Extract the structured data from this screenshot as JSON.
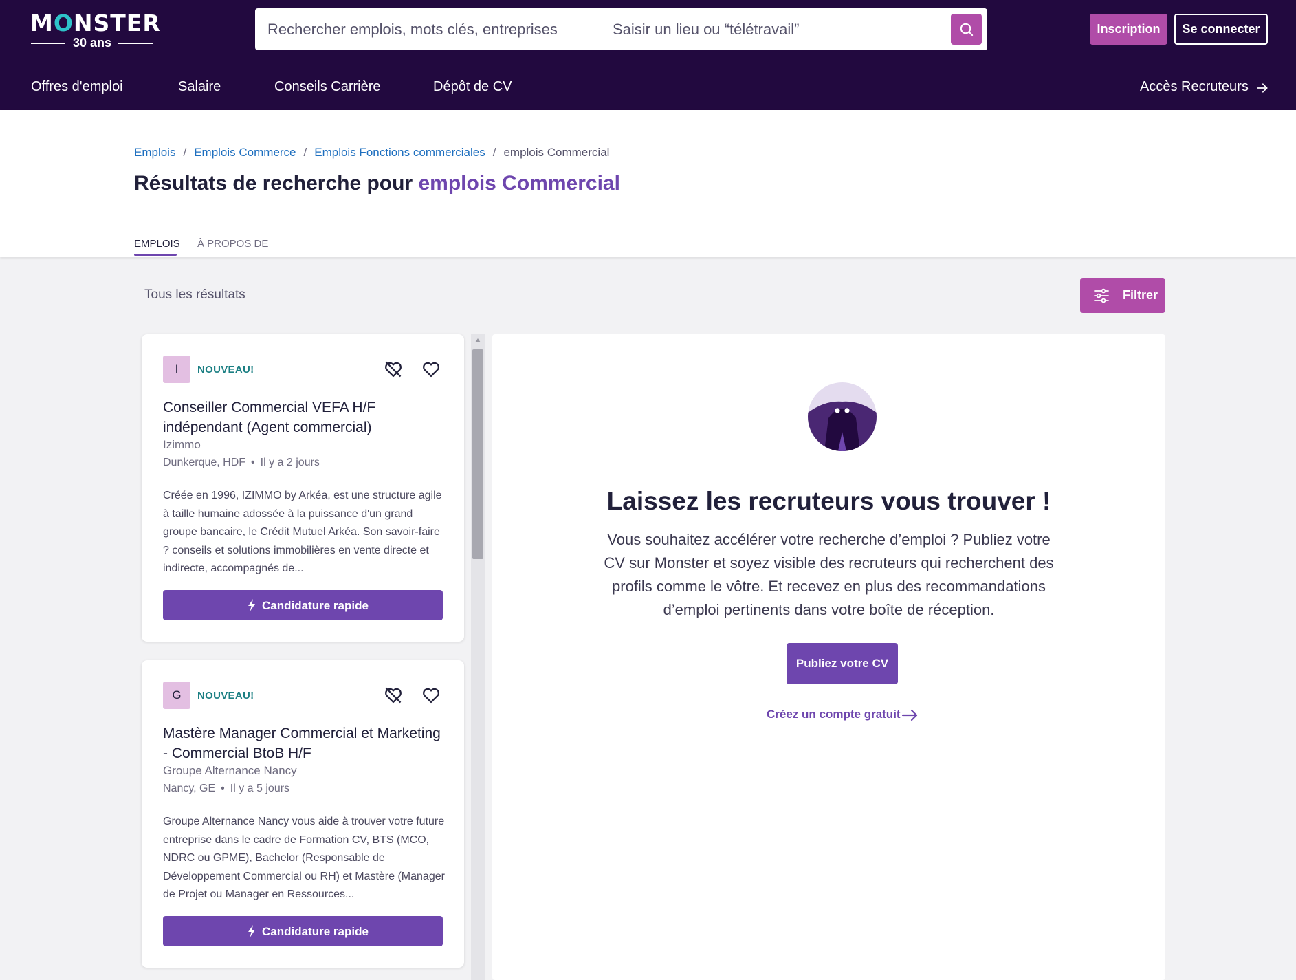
{
  "header": {
    "logo_text_pre": "M",
    "logo_text_o": "O",
    "logo_text_post": "NSTER",
    "logo_subtitle": "30 ans",
    "search_query_placeholder": "Rechercher emplois, mots clés, entreprises",
    "search_location_placeholder": "Saisir un lieu ou “télétravail”",
    "signup_label": "Inscription",
    "login_label": "Se connecter",
    "nav": [
      "Offres d'emploi",
      "Salaire",
      "Conseils Carrière",
      "Dépôt de CV"
    ],
    "recruiter_label": "Accès Recruteurs",
    "icons": [
      "search-icon",
      "arrow-right-icon"
    ]
  },
  "breadcrumb": {
    "items": [
      "Emplois",
      "Emplois Commerce",
      "Emplois Fonctions commerciales"
    ],
    "current": "emplois Commercial"
  },
  "title": {
    "prefix": "Résultats de recherche pour",
    "highlight": "emplois Commercial"
  },
  "tabs": [
    "EMPLOIS",
    "À PROPOS DE"
  ],
  "results": {
    "label": "Tous les résultats",
    "filter_label": "Filtrer"
  },
  "jobs": [
    {
      "logo_letter": "I",
      "badge": "NOUVEAU!",
      "title": "Conseiller Commercial VEFA H/F indépendant (Agent commercial)",
      "company": "Izimmo",
      "location": "Dunkerque, HDF",
      "posted": "Il y a 2 jours",
      "description": "Créée en 1996, IZIMMO by Arkéa, est une structure agile à taille humaine adossée à la puissance d'un grand groupe bancaire, le Crédit Mutuel Arkéa. Son savoir-faire ? conseils et solutions immobilières en vente directe et indirecte, accompagnés de...",
      "apply_label": "Candidature rapide"
    },
    {
      "logo_letter": "G",
      "badge": "NOUVEAU!",
      "title": "Mastère Manager Commercial et Marketing - Commercial BtoB H/F",
      "company": "Groupe Alternance Nancy",
      "location": "Nancy, GE",
      "posted": "Il y a 5 jours",
      "description": "Groupe Alternance Nancy vous aide à trouver votre future entreprise dans le cadre de Formation CV, BTS (MCO, NDRC ou GPME), Bachelor (Responsable de Développement Commercial ou RH) et Mastère (Manager de Projet ou Manager en Ressources...",
      "apply_label": "Candidature rapide"
    }
  ],
  "promo": {
    "heading": "Laissez les recruteurs vous trouver !",
    "body": "Vous souhaitez accélérer votre recherche d’emploi ? Publiez votre CV sur Monster et soyez visible des recruteurs qui recherchent des profils comme le vôtre. Et recevez en plus des recommandations d’emploi pertinents dans votre boîte de réception.",
    "cta_label": "Publiez votre CV",
    "link_label": "Créez un compte gratuit"
  },
  "colors": {
    "header_bg": "#22093f",
    "accent_pink": "#b04ca8",
    "accent_purple": "#6e46ae",
    "badge_teal": "#1b7f83"
  }
}
